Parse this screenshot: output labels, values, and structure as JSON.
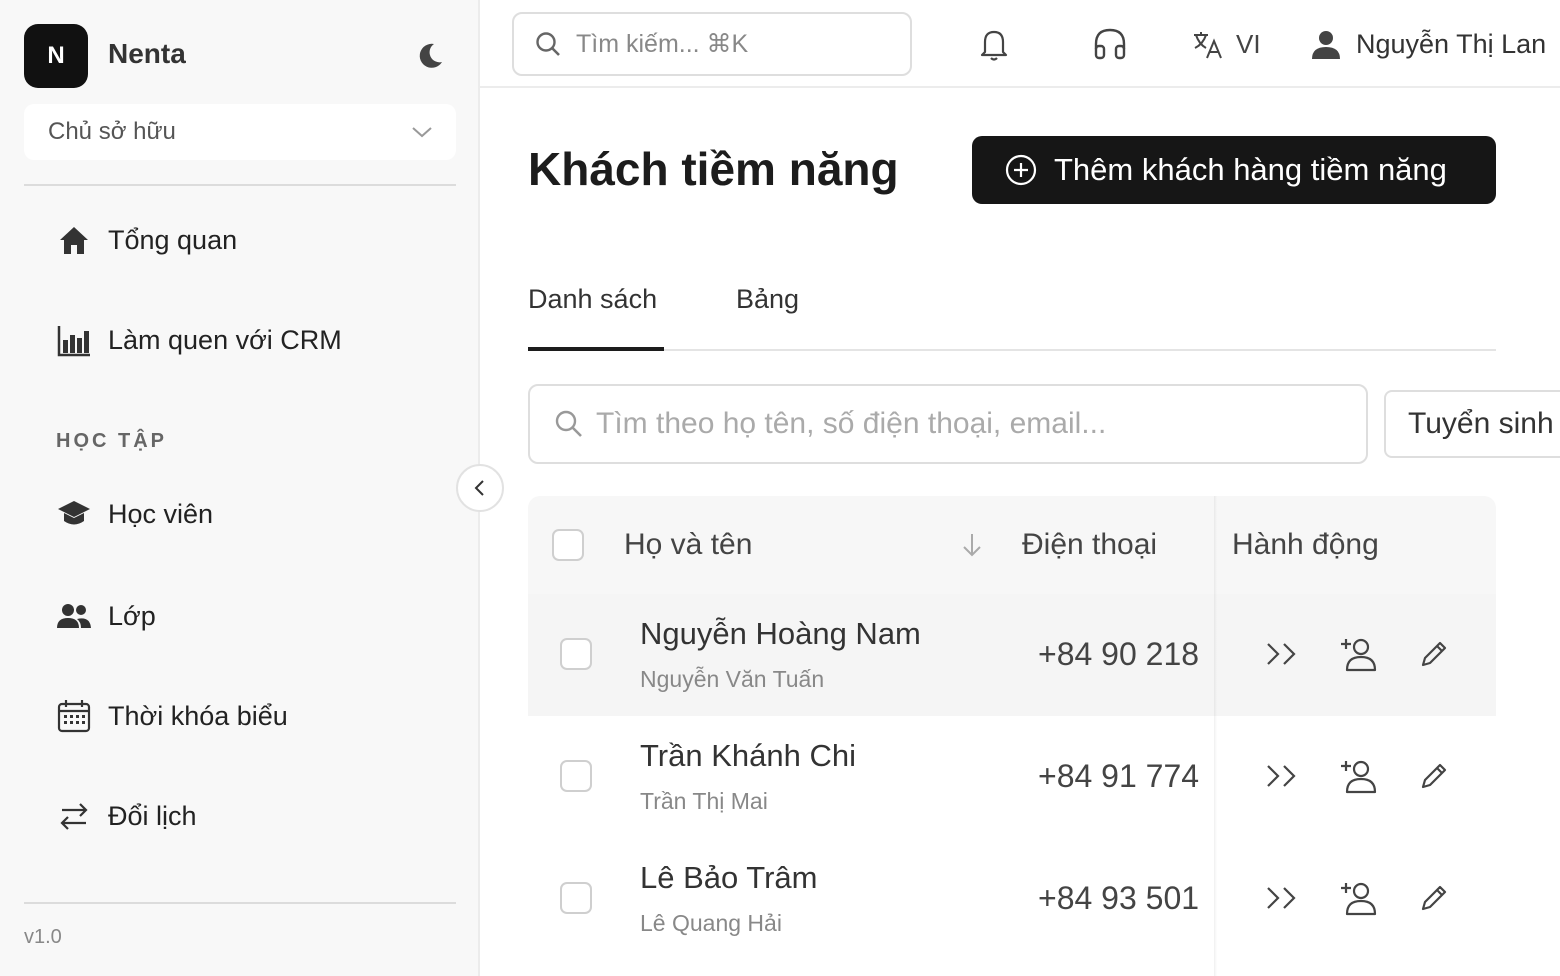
{
  "sidebar": {
    "logo_letter": "N",
    "brand": "Nenta",
    "owner_select": "Chủ sở hữu",
    "items_top": [
      {
        "label": "Tổng quan",
        "icon": "home-icon"
      },
      {
        "label": "Làm quen với CRM",
        "icon": "bar-chart-icon"
      }
    ],
    "section_label": "HỌC TẬP",
    "items_study": [
      {
        "label": "Học viên",
        "icon": "graduation-cap-icon"
      },
      {
        "label": "Lớp",
        "icon": "users-icon"
      },
      {
        "label": "Thời khóa biểu",
        "icon": "calendar-icon"
      },
      {
        "label": "Đổi lịch",
        "icon": "swap-icon"
      }
    ],
    "version": "v1.0"
  },
  "topbar": {
    "search_placeholder": "Tìm kiếm... ⌘K",
    "language": "VI",
    "user_name": "Nguyễn Thị Lan"
  },
  "main": {
    "title": "Khách tiềm năng",
    "add_button": "Thêm khách hàng tiềm năng",
    "tabs": [
      "Danh sách",
      "Bảng"
    ],
    "active_tab": "Danh sách",
    "list_search_placeholder": "Tìm theo họ tên, số điện thoại, email...",
    "filter_value": "Tuyển sinh"
  },
  "table": {
    "columns": {
      "name": "Họ và tên",
      "phone": "Điện thoại",
      "actions": "Hành động"
    },
    "rows": [
      {
        "name": "Nguyễn Hoàng Nam",
        "parent": "Nguyễn Văn Tuấn",
        "phone": "+84 90 218"
      },
      {
        "name": "Trần Khánh Chi",
        "parent": "Trần Thị Mai",
        "phone": "+84 91 774"
      },
      {
        "name": "Lê Bảo Trâm",
        "parent": "Lê Quang Hải",
        "phone": "+84 93 501"
      }
    ]
  },
  "colors": {
    "primary": "#161616",
    "sidebar_bg": "#f8f8f8",
    "border": "#dedede"
  }
}
